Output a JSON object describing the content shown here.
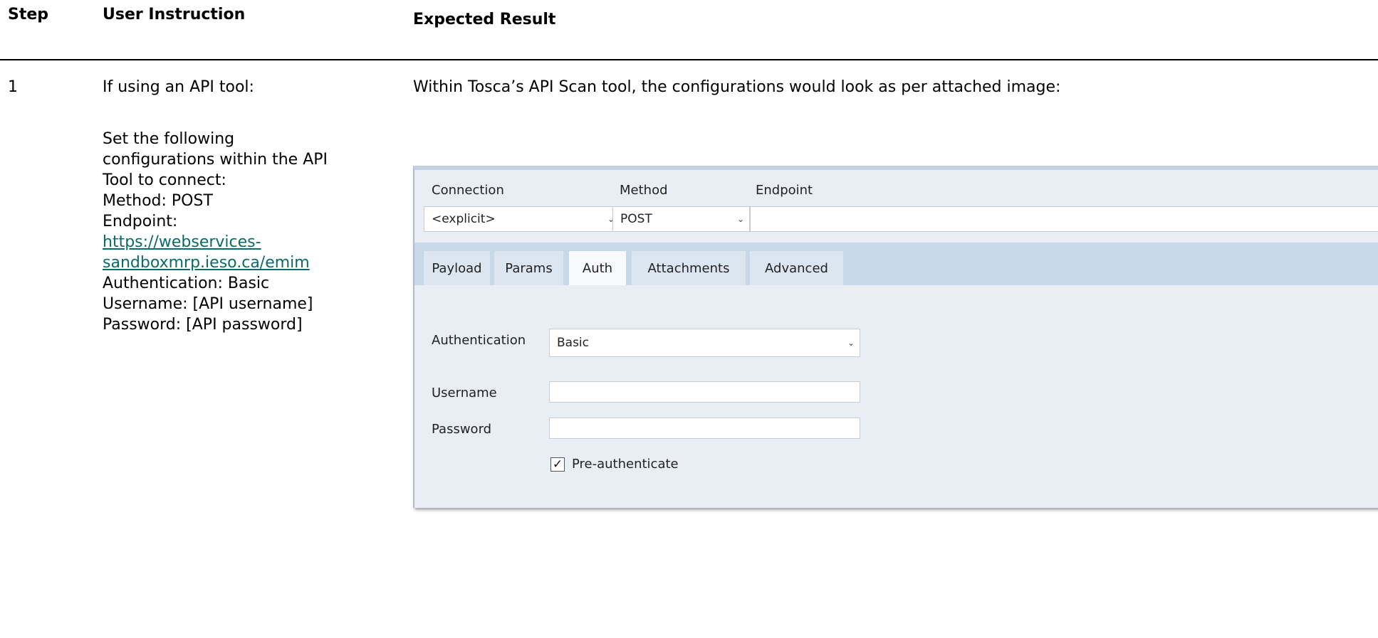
{
  "table": {
    "headers": {
      "step": "Step",
      "instruction": "User Instruction",
      "expected": "Expected Result"
    },
    "row": {
      "step": "1",
      "instruction_intro": "If using an API tool:",
      "instruction_lines": [
        "Set the following",
        "configurations within the API",
        "Tool to connect:",
        "Method: POST",
        "Endpoint:"
      ],
      "endpoint_link_lines": [
        "https://webservices-",
        "sandboxmrp.ieso.ca/emim"
      ],
      "instruction_tail": [
        "Authentication: Basic",
        "Username: [API username]",
        "Password: [API password]"
      ],
      "expected_text": "Within Tosca’s API Scan tool, the configurations would look as per attached image:"
    }
  },
  "api_scan": {
    "labels": {
      "connection": "Connection",
      "method": "Method",
      "endpoint": "Endpoint"
    },
    "connection_value": "<explicit>",
    "method_value": "POST",
    "endpoint_value": "",
    "tabs": [
      "Payload",
      "Params",
      "Auth",
      "Attachments",
      "Advanced"
    ],
    "active_tab": "Auth",
    "auth": {
      "authentication_label": "Authentication",
      "authentication_value": "Basic",
      "username_label": "Username",
      "username_value": "",
      "password_label": "Password",
      "password_value": "",
      "preauth_label": "Pre-authenticate",
      "preauth_checked": true
    },
    "colors": {
      "panel_bg": "#e9eef5",
      "tab_bar": "#c8d8e8",
      "active_tab": "#f7f9fc",
      "link": "#0b6a6a"
    }
  }
}
